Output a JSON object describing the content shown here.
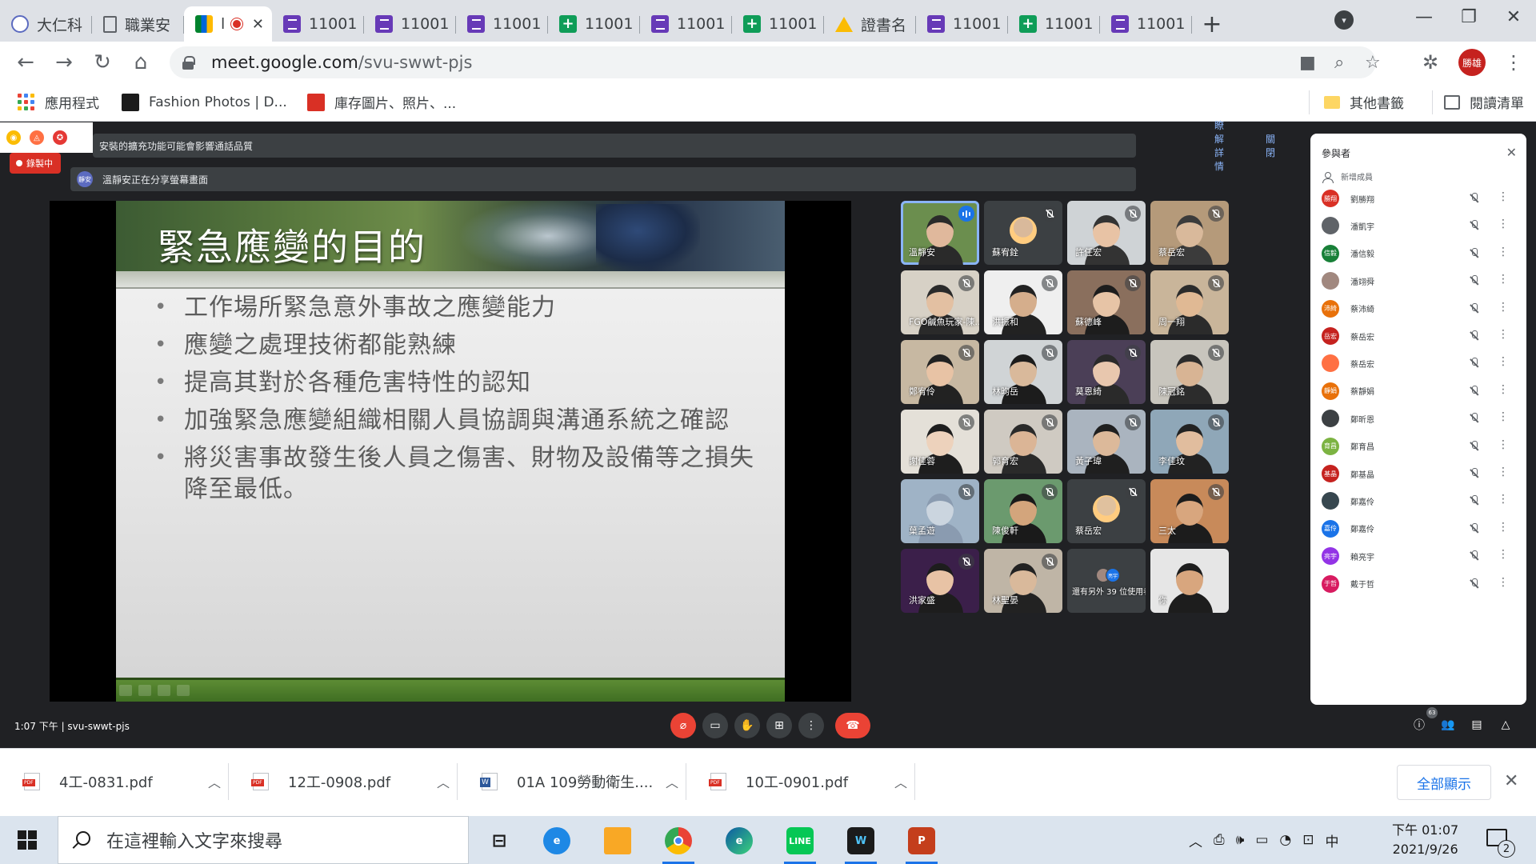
{
  "browser": {
    "tabs": [
      {
        "title": "大仁科",
        "icon": "university-icon"
      },
      {
        "title": "職業安",
        "icon": "document-icon"
      },
      {
        "title": "l",
        "icon": "google-meet-icon",
        "active": true,
        "recording": true
      },
      {
        "title": "11001",
        "icon": "google-forms-icon"
      },
      {
        "title": "11001",
        "icon": "google-forms-icon"
      },
      {
        "title": "11001",
        "icon": "google-forms-icon"
      },
      {
        "title": "11001",
        "icon": "google-sheets-icon"
      },
      {
        "title": "11001",
        "icon": "google-forms-icon"
      },
      {
        "title": "11001",
        "icon": "google-sheets-icon"
      },
      {
        "title": "證書名",
        "icon": "google-drive-icon"
      },
      {
        "title": "11001",
        "icon": "google-forms-icon"
      },
      {
        "title": "11001",
        "icon": "google-sheets-icon"
      },
      {
        "title": "11001",
        "icon": "google-forms-icon"
      }
    ],
    "new_tab": "+",
    "url_host": "meet.google.com",
    "url_path": "/svu-swwt-pjs",
    "profile_initials": "勝雄",
    "bookmarks": [
      {
        "label": "應用程式"
      },
      {
        "label": "Fashion Photos | D..."
      },
      {
        "label": "庫存圖片、照片、..."
      }
    ],
    "other_bookmarks": "其他書籤",
    "reading_list": "閱讀清單"
  },
  "meet": {
    "recording_label": "錄製中",
    "banner1_text": "安裝的擴充功能可能會影響通話品質",
    "banner1_link1": "瞭解詳情",
    "banner1_link2": "關閉",
    "banner2_avatar": "靜安",
    "banner2_text": "溫靜安正在分享螢幕畫面",
    "slide": {
      "title": "緊急應變的目的",
      "bullets": [
        "工作場所緊急意外事故之應變能力",
        "應變之處理技術都能熟練",
        "提高其對於各種危害特性的認知",
        "加強緊急應變組織相關人員協調與溝通系統之確認",
        "將災害事故發生後人員之傷害、財物及設備等之損失降至最低。"
      ]
    },
    "tiles": [
      {
        "name": "溫靜安",
        "speaking": true
      },
      {
        "name": "蘇宥銓"
      },
      {
        "name": "許任宏"
      },
      {
        "name": "蔡岳宏"
      },
      {
        "name": "FGO鹹魚玩家-陳..."
      },
      {
        "name": "洪振和"
      },
      {
        "name": "蘇德峰"
      },
      {
        "name": "周一翔"
      },
      {
        "name": "鄭宥伶"
      },
      {
        "name": "林昀岳"
      },
      {
        "name": "莫恩綺"
      },
      {
        "name": "陳冠銘"
      },
      {
        "name": "謝佳蓉"
      },
      {
        "name": "郭育宏"
      },
      {
        "name": "黃子瑋"
      },
      {
        "name": "李佳玟"
      },
      {
        "name": "葉孟遊"
      },
      {
        "name": "陳俊軒"
      },
      {
        "name": "蔡岳宏"
      },
      {
        "name": "三太"
      },
      {
        "name": "洪家盛"
      },
      {
        "name": "林聖晏"
      },
      {
        "name": "還有另外 39 位使用者",
        "overflow_avatar": "亮宇"
      },
      {
        "name": "你"
      }
    ],
    "people_panel": {
      "title": "參與者",
      "close": "✕",
      "add_people": "新增成員",
      "list": [
        {
          "name": "劉勝翔",
          "avatar": "勝翔",
          "color": "#d93025"
        },
        {
          "name": "潘凱宇",
          "avatar": "",
          "color": "#5f6368"
        },
        {
          "name": "潘信毅",
          "avatar": "信毅",
          "color": "#188038"
        },
        {
          "name": "潘翊舜",
          "avatar": "",
          "color": "#a1887f"
        },
        {
          "name": "蔡沛綺",
          "avatar": "沛綺",
          "color": "#e8710a"
        },
        {
          "name": "蔡岳宏",
          "avatar": "岳宏",
          "color": "#c5221f"
        },
        {
          "name": "蔡岳宏",
          "avatar": "",
          "color": "#ff7043"
        },
        {
          "name": "蔡靜娟",
          "avatar": "靜娟",
          "color": "#e8710a"
        },
        {
          "name": "鄭昕恩",
          "avatar": "",
          "color": "#3c4043"
        },
        {
          "name": "鄭育昌",
          "avatar": "育昌",
          "color": "#7cb342"
        },
        {
          "name": "鄭基晶",
          "avatar": "基晶",
          "color": "#c5221f"
        },
        {
          "name": "鄭嘉伶",
          "avatar": "",
          "color": "#37474f"
        },
        {
          "name": "鄭嘉伶",
          "avatar": "嘉伶",
          "color": "#1a73e8"
        },
        {
          "name": "賴亮宇",
          "avatar": "亮宇",
          "color": "#9334e6"
        },
        {
          "name": "戴于哲",
          "avatar": "于哲",
          "color": "#d81b60"
        }
      ]
    },
    "time_code": "1:07 下午  |  svu-swwt-pjs",
    "participant_count": "63"
  },
  "downloads": {
    "items": [
      {
        "name": "4工-0831.pdf",
        "type": "pdf"
      },
      {
        "name": "12工-0908.pdf",
        "type": "pdf"
      },
      {
        "name": "01A 109勞動衛生....doc",
        "type": "doc"
      },
      {
        "name": "10工-0901.pdf",
        "type": "pdf"
      }
    ],
    "show_all": "全部顯示"
  },
  "taskbar": {
    "search_placeholder": "在這裡輸入文字來搜尋",
    "ime": "中",
    "time": "下午 01:07",
    "date": "2021/9/26",
    "notification_count": "2"
  }
}
